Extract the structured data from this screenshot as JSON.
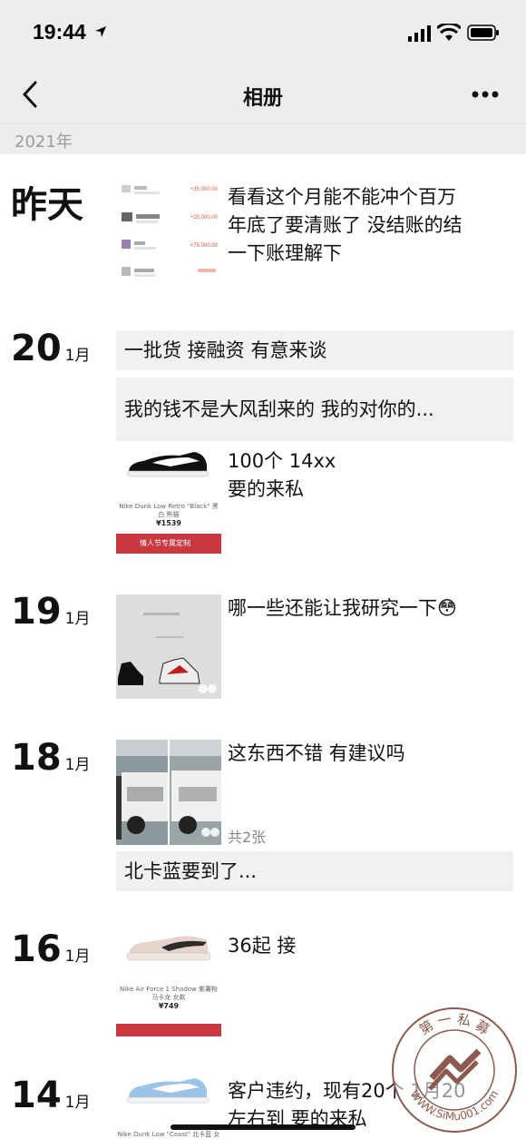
{
  "status": {
    "time": "19:44"
  },
  "nav": {
    "title": "相册",
    "back": "back",
    "more": "more"
  },
  "year": "2021年",
  "month_unit": "1月",
  "posts": [
    {
      "day": "昨天",
      "text_line1": "看看这个月能不能冲个百万",
      "text_line2": "年底了要清账了 没结账的结",
      "text_line3": "一下账理解下",
      "amounts": [
        "+35,000.00",
        "+25,000.00",
        "+75,000.00"
      ]
    },
    {
      "day": "20",
      "text_box1": "一批货 接融资 有意来谈",
      "text_box2": "我的钱不是大风刮来的 我的对你的...",
      "text_line1": "100个 14xx",
      "text_line2": "要的来私",
      "shoe_caption": "Nike Dunk Low Retro \"Black\" 黑白 熊猫",
      "shoe_price": "¥1539",
      "banner": "情人节专属定制"
    },
    {
      "day": "19",
      "text_line1": "哪一些还能让我研究一下😳"
    },
    {
      "day": "18",
      "text_line1": "这东西不错 有建议吗",
      "photo_count": "共2张",
      "text_box1": "北卡蓝要到了..."
    },
    {
      "day": "16",
      "text_line1": "36起 接",
      "shoe_caption": "Nike Air Force 1 Shadow 紫薯粉 马卡龙 女款",
      "shoe_price": "¥749"
    },
    {
      "day": "14",
      "text_line1": "客户违约，现有20个 1月20",
      "text_line2": "左右到 要的来私",
      "shoe_caption": "Nike Dunk Low \"Coast\" 北卡蓝 女款"
    }
  ],
  "watermark": {
    "top": "第 一 私 募",
    "bottom": "WWW.SiMu001.com"
  }
}
